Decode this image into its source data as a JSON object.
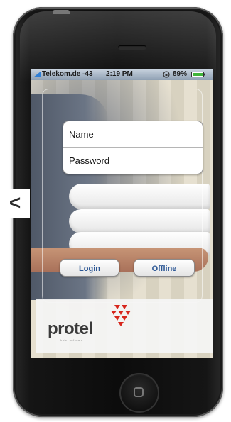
{
  "status_bar": {
    "carrier": "Telekom.de -43",
    "time": "2:19 PM",
    "battery": "89%"
  },
  "login_form": {
    "name_placeholder": "Name",
    "password_placeholder": "Password"
  },
  "buttons": {
    "login": "Login",
    "offline": "Offline"
  },
  "logo": {
    "text": "protel",
    "tagline": "hotel software",
    "colors": {
      "brand_red": "#d7261c",
      "text_gray": "#3a3a3a"
    }
  },
  "nav": {
    "back_arrow": "<"
  },
  "icons": [
    "signal-icon",
    "rotation-lock-icon",
    "battery-icon",
    "protel-logo-mark-icon",
    "home-button-icon"
  ]
}
